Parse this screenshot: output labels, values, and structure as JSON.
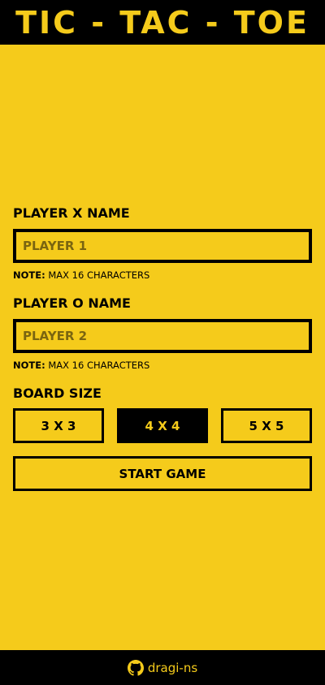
{
  "header": {
    "title": "TIC - TAC - TOE"
  },
  "form": {
    "player_x": {
      "label": "PLAYER X NAME",
      "placeholder": "PLAYER 1",
      "value": "",
      "note_bold": "NOTE:",
      "note_text": " MAX 16 CHARACTERS"
    },
    "player_o": {
      "label": "PLAYER O NAME",
      "placeholder": "PLAYER 2",
      "value": "",
      "note_bold": "NOTE:",
      "note_text": " MAX 16 CHARACTERS"
    },
    "board_size": {
      "label": "BOARD SIZE",
      "options": [
        "3 X 3",
        "4 X 4",
        "5 X 5"
      ],
      "selected": "4 X 4"
    },
    "start_label": "START GAME"
  },
  "footer": {
    "icon": "github-icon",
    "link_text": "dragi-ns"
  },
  "colors": {
    "background": "#f5cb1b",
    "dark": "#000000",
    "accent": "#f5cb1b"
  }
}
